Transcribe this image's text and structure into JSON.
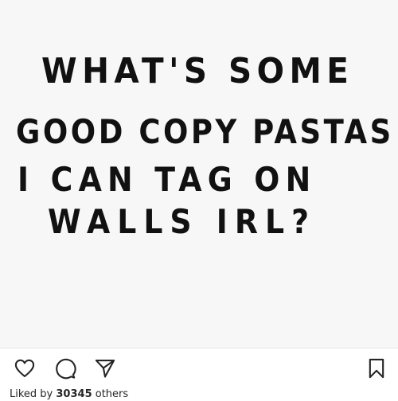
{
  "post": {
    "handwritten_lines": [
      "WHAT'S SOME",
      "GOOD COPY PASTAS",
      "I CAN TAG ON",
      "WALLS IRL?"
    ],
    "text_color": "#111111",
    "background_color": "#f7f7f7"
  },
  "actions": {
    "like_icon": "heart-icon",
    "comment_icon": "comment-bubble-icon",
    "share_icon": "paper-plane-icon",
    "save_icon": "bookmark-icon"
  },
  "likes": {
    "prefix": "Liked by ",
    "count": "30345",
    "suffix": " others"
  }
}
